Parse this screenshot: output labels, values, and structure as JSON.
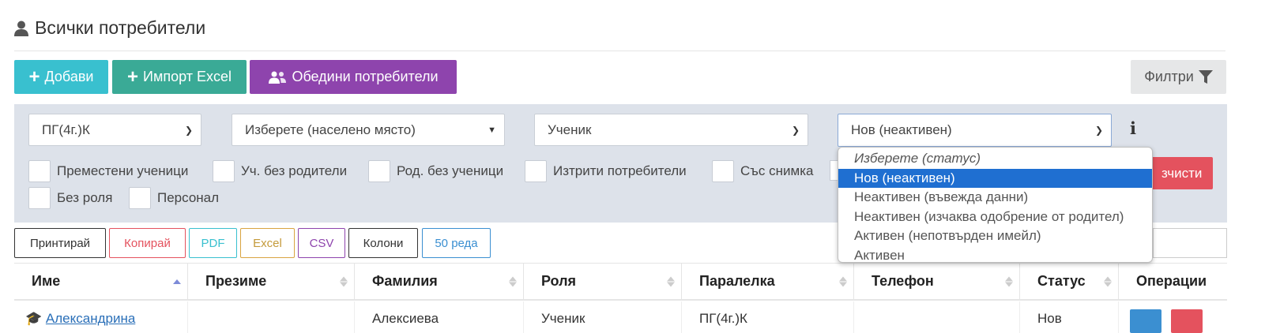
{
  "page_title": "Всички потребители",
  "toolbar": {
    "add_label": "Добави",
    "import_label": "Импорт Excel",
    "merge_label": "Обедини потребители",
    "filters_label": "Филтри"
  },
  "filters": {
    "class_select": "ПГ(4г.)К",
    "place_select": "Изберете (населено място)",
    "role_select": "Ученик",
    "status_select": "Нов (неактивен)",
    "checkboxes": [
      "Преместени ученици",
      "Уч. без родители",
      "Род. без ученици",
      "Изтрити потребители",
      "Със снимка",
      "Без роля",
      "Персонал"
    ],
    "clear_label": "зчисти",
    "info_glyph": "i"
  },
  "status_dropdown": {
    "options": [
      "Изберете (статус)",
      "Нов (неактивен)",
      "Неактивен (въвежда данни)",
      "Неактивен (изчаква одобрение от родител)",
      "Активен (непотвърден имейл)",
      "Активен"
    ],
    "selected_index": 1
  },
  "table_buttons": [
    "Принтирай",
    "Копирай",
    "PDF",
    "Excel",
    "CSV",
    "Колони",
    "50 реда"
  ],
  "table": {
    "headers": [
      "Име",
      "Презиме",
      "Фамилия",
      "Роля",
      "Паралелка",
      "Телефон",
      "Статус",
      "Операции"
    ],
    "row": [
      "Александрина",
      "",
      "Алексиева",
      "Ученик",
      "ПГ(4г.)К",
      "",
      "Нов",
      ""
    ]
  },
  "colors": {
    "add": "#39c0cf",
    "import": "#3aaa96",
    "merge": "#8e44ad",
    "danger": "#e4525e",
    "selected": "#1f6fd1"
  }
}
